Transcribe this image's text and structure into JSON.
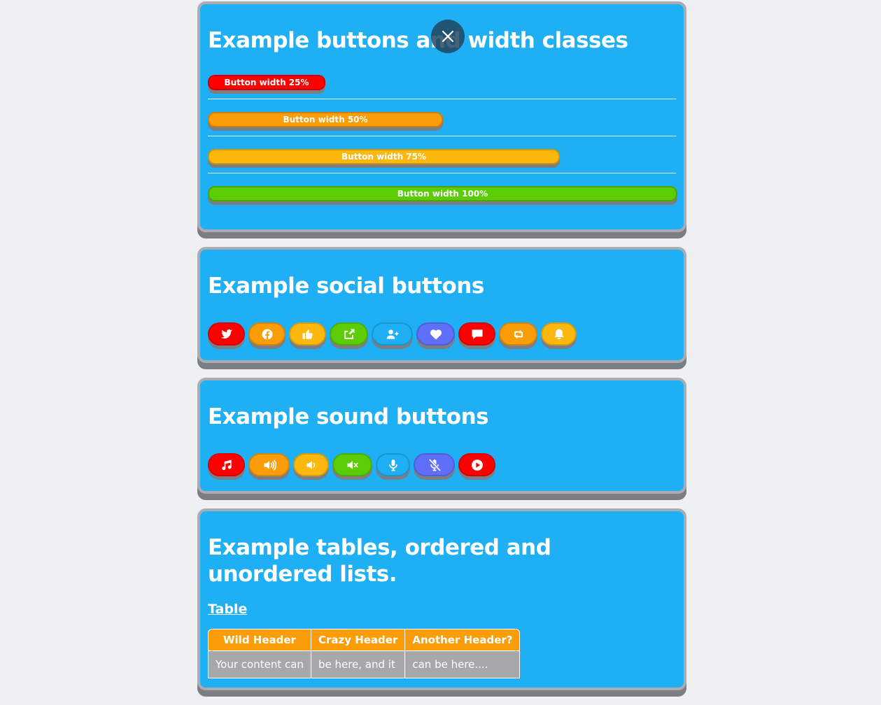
{
  "close_button": {
    "icon": "close-icon"
  },
  "widths_section": {
    "title": "Example buttons and width classes",
    "buttons": [
      {
        "label": "Button width 25%",
        "width_fraction": 0.25,
        "color": "#fe0000"
      },
      {
        "label": "Button width 50%",
        "width_fraction": 0.5,
        "color": "#fb9c09"
      },
      {
        "label": "Button width 75%",
        "width_fraction": 0.75,
        "color": "#fdb80d"
      },
      {
        "label": "Button width 100%",
        "width_fraction": 1.0,
        "color": "#5bcc05"
      }
    ]
  },
  "social_section": {
    "title": "Example social buttons",
    "buttons": [
      {
        "icon": "twitter-icon",
        "color": "#fe0000"
      },
      {
        "icon": "facebook-icon",
        "color": "#fb9c09"
      },
      {
        "icon": "thumbs-up-icon",
        "color": "#fdb80d"
      },
      {
        "icon": "share-icon",
        "color": "#5bcc05"
      },
      {
        "icon": "add-user-icon",
        "color": "#1eaff4"
      },
      {
        "icon": "heart-icon",
        "color": "#5f6ff9"
      },
      {
        "icon": "comment-icon",
        "color": "#fe0000"
      },
      {
        "icon": "retweet-icon",
        "color": "#fb9c09"
      },
      {
        "icon": "bell-icon",
        "color": "#fdb80d"
      }
    ]
  },
  "sound_section": {
    "title": "Example sound buttons",
    "buttons": [
      {
        "icon": "music-note-icon",
        "color": "#fe0000"
      },
      {
        "icon": "volume-up-icon",
        "color": "#fb9c09"
      },
      {
        "icon": "volume-down-icon",
        "color": "#fdb80d"
      },
      {
        "icon": "volume-mute-icon",
        "color": "#5bcc05"
      },
      {
        "icon": "microphone-icon",
        "color": "#1eaff4"
      },
      {
        "icon": "microphone-off-icon",
        "color": "#5f6ff9"
      },
      {
        "icon": "play-icon",
        "color": "#fe0000"
      }
    ]
  },
  "tables_section": {
    "title": "Example tables, ordered and unordered lists.",
    "table_link": "Table",
    "table": {
      "headers": [
        "Wild Header",
        "Crazy Header",
        "Another Header?"
      ],
      "rows": [
        [
          "Your content can",
          "be here, and it",
          "can be here...."
        ]
      ]
    }
  }
}
